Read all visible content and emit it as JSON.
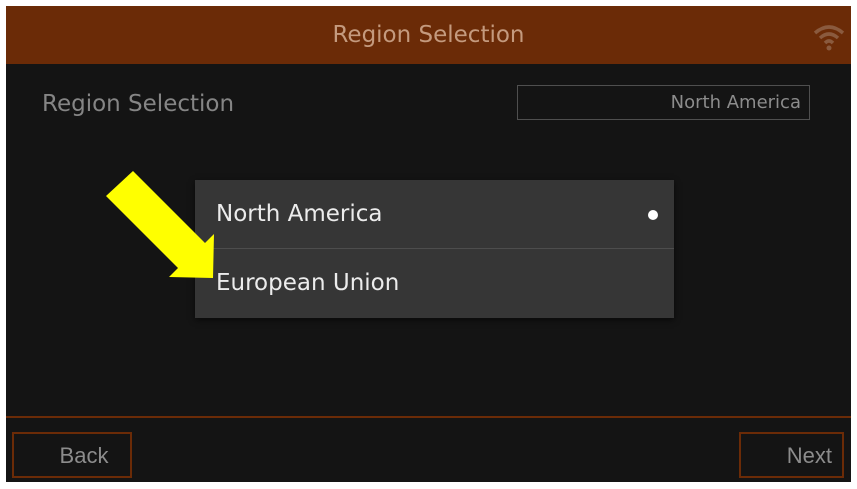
{
  "header": {
    "title": "Region Selection",
    "icon": "wifi-icon"
  },
  "setting": {
    "label": "Region Selection",
    "value": "North America"
  },
  "dropdown": {
    "options": [
      {
        "label": "North America",
        "selected": true
      },
      {
        "label": "European Union",
        "selected": false
      }
    ]
  },
  "footer": {
    "back_label": "Back",
    "next_label": "Next"
  },
  "annotation": {
    "type": "arrow",
    "color": "#ffff00",
    "points_to": "European Union"
  },
  "colors": {
    "accent": "#6b2b07",
    "background": "#141414",
    "popup": "#363636",
    "annotation": "#ffff00"
  }
}
